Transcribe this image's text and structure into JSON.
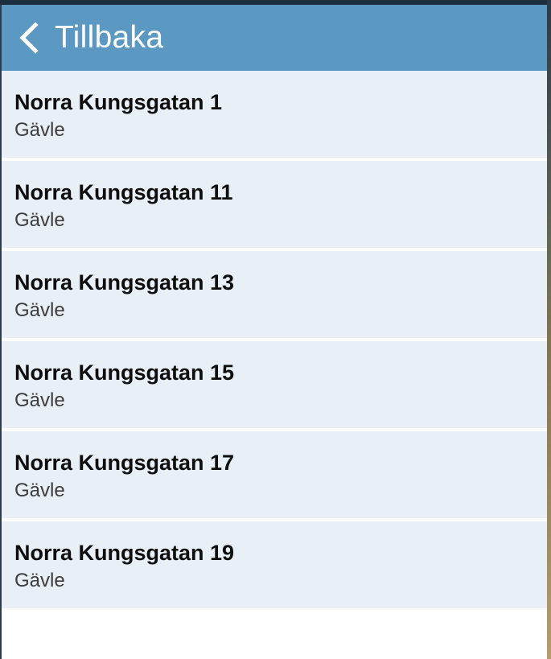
{
  "header": {
    "back_label": "Tillbaka",
    "icon": "chevron-left-icon",
    "background_color": "#5b99c2"
  },
  "addresses": [
    {
      "street": "Norra Kungsgatan 1",
      "city": "Gävle"
    },
    {
      "street": "Norra Kungsgatan 11",
      "city": "Gävle"
    },
    {
      "street": "Norra Kungsgatan 13",
      "city": "Gävle"
    },
    {
      "street": "Norra Kungsgatan 15",
      "city": "Gävle"
    },
    {
      "street": "Norra Kungsgatan 17",
      "city": "Gävle"
    },
    {
      "street": "Norra Kungsgatan 19",
      "city": "Gävle"
    }
  ],
  "colors": {
    "list_item_background": "#e8eff6",
    "accent": "#5b99c2"
  }
}
